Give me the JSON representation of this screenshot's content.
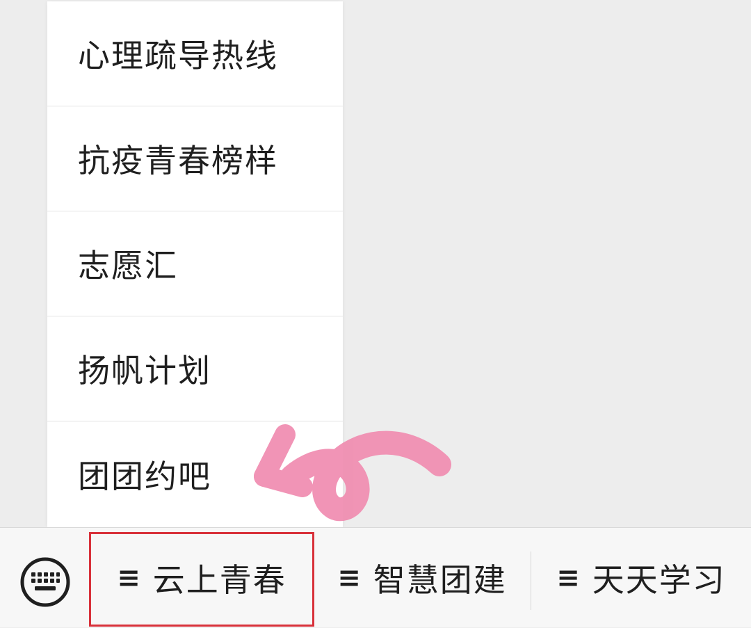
{
  "submenu": {
    "items": [
      {
        "label": "心理疏导热线"
      },
      {
        "label": "抗疫青春榜样"
      },
      {
        "label": "志愿汇"
      },
      {
        "label": "扬帆计划"
      },
      {
        "label": "团团约吧"
      }
    ]
  },
  "menubar": {
    "keyboard_icon": "keyboard-icon",
    "menu_glyph": "≡",
    "tabs": [
      {
        "label": "云上青春",
        "active": true
      },
      {
        "label": "智慧团建"
      },
      {
        "label": "天天学习"
      }
    ]
  },
  "colors": {
    "background": "#ededed",
    "menu_background": "#ffffff",
    "highlight_frame": "#d8313a",
    "annotation_arrow": "#f08cb0"
  }
}
